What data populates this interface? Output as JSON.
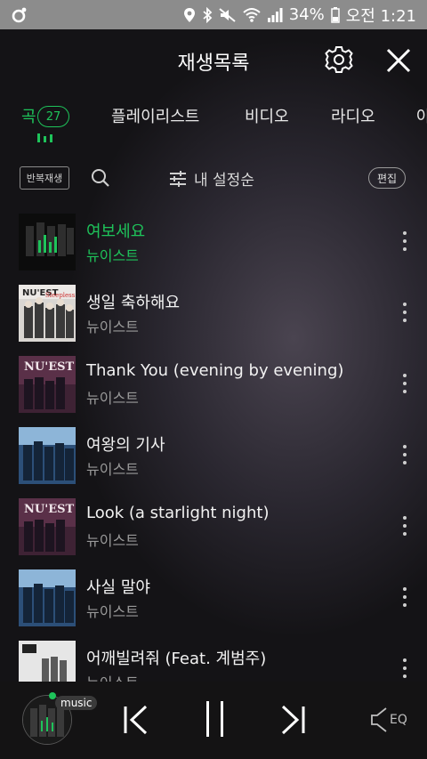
{
  "status": {
    "battery": "34%",
    "time": "오전 1:21"
  },
  "header": {
    "title": "재생목록"
  },
  "tabs": [
    {
      "label": "곡",
      "active": true,
      "count": "27"
    },
    {
      "label": "플레이리스트"
    },
    {
      "label": "비디오"
    },
    {
      "label": "라디오"
    },
    {
      "label": "아"
    }
  ],
  "toolbar": {
    "repeat_label": "반복재생",
    "sort_label": "내 설정순",
    "edit_label": "편집"
  },
  "songs": [
    {
      "title": "여보세요",
      "artist": "뉴이스트",
      "playing": true
    },
    {
      "title": "생일 축하해요",
      "artist": "뉴이스트"
    },
    {
      "title": "Thank You (evening by evening)",
      "artist": "뉴이스트"
    },
    {
      "title": "여왕의 기사",
      "artist": "뉴이스트"
    },
    {
      "title": "Look (a starlight night)",
      "artist": "뉴이스트"
    },
    {
      "title": "사실 말야",
      "artist": "뉴이스트"
    },
    {
      "title": "어깨빌려줘 (Feat. 계범주)",
      "artist": "뉴이스트"
    }
  ],
  "player": {
    "source_label": "music",
    "eq_label": "EQ"
  },
  "colors": {
    "accent": "#1ec35a",
    "status_bar": "#8c8c8c",
    "background": "#141316"
  }
}
